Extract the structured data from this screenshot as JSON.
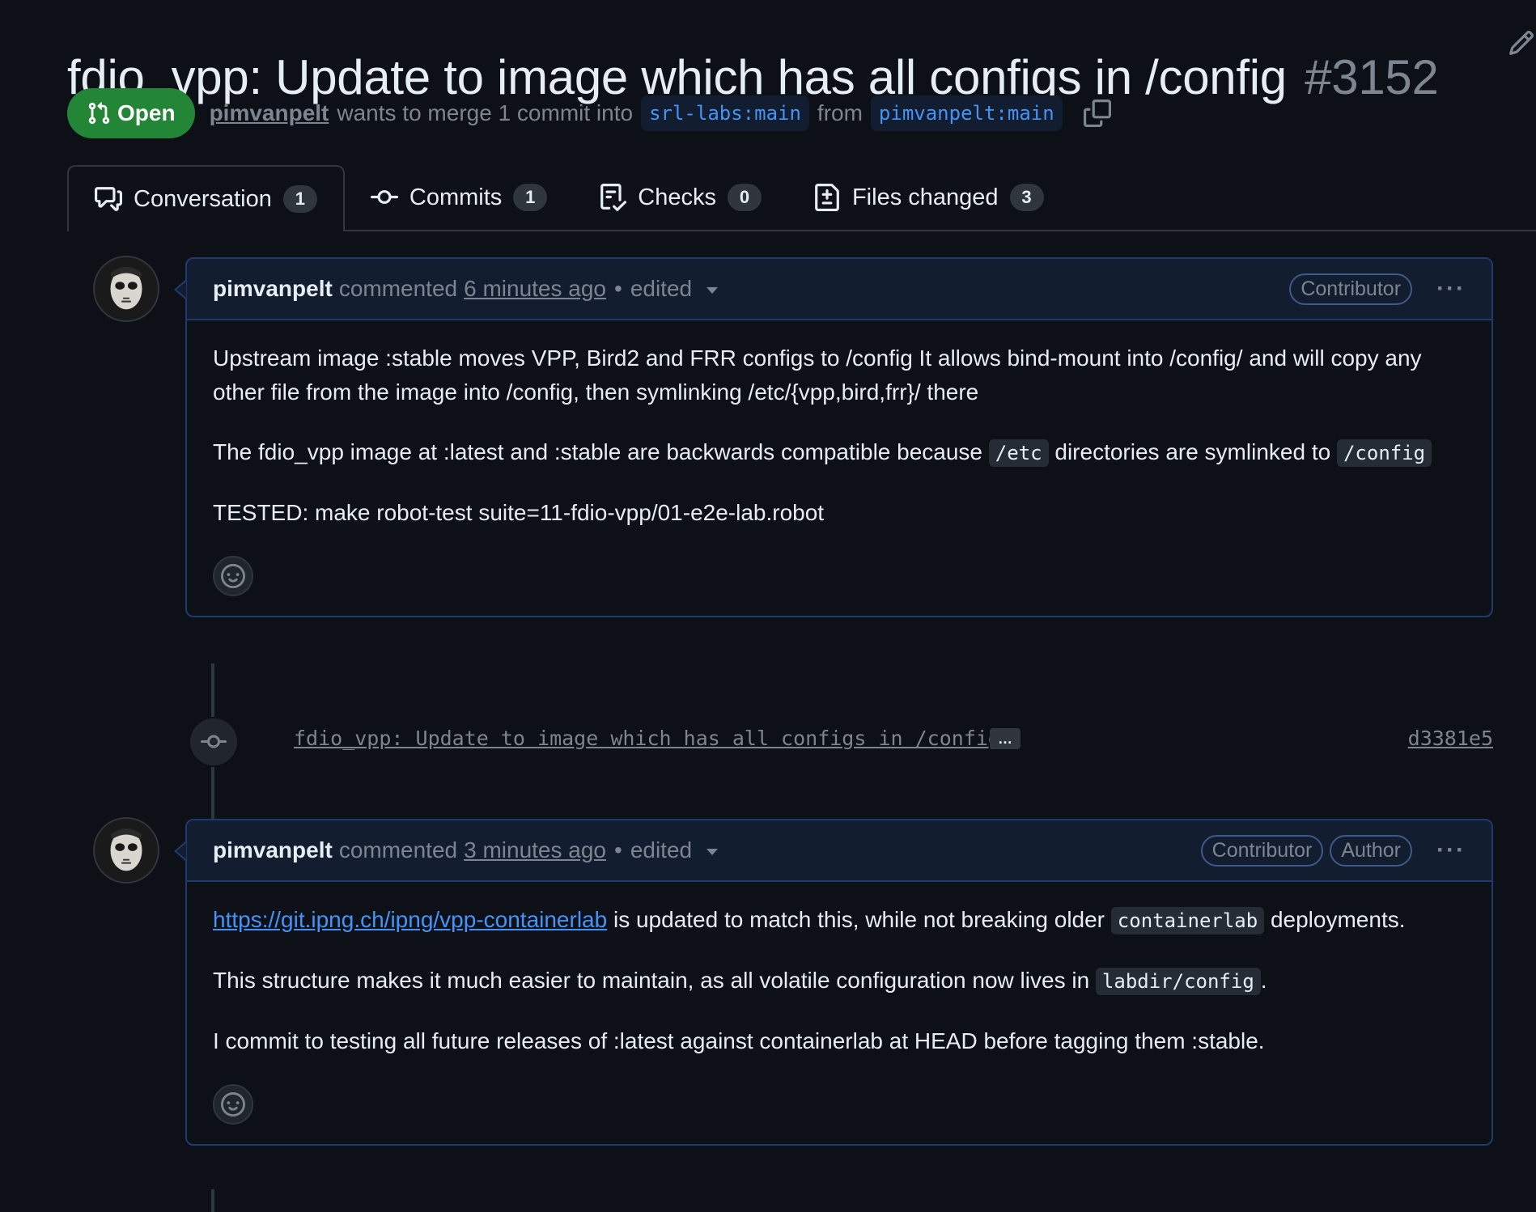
{
  "pr": {
    "title": "fdio_vpp: Update to image which has all configs in /config",
    "number": "#3152",
    "state": "Open",
    "author": "pimvanpelt",
    "merge_text": "wants to merge 1 commit into",
    "base_branch": "srl-labs:main",
    "from_text": "from",
    "head_branch": "pimvanpelt:main"
  },
  "tabs": [
    {
      "label": "Conversation",
      "count": "1",
      "icon": "comment-discussion-icon"
    },
    {
      "label": "Commits",
      "count": "1",
      "icon": "git-commit-icon"
    },
    {
      "label": "Checks",
      "count": "0",
      "icon": "checklist-icon"
    },
    {
      "label": "Files changed",
      "count": "3",
      "icon": "file-diff-icon"
    }
  ],
  "comments": [
    {
      "author": "pimvanpelt",
      "action": "commented",
      "time": "6 minutes ago",
      "dot": "•",
      "edited": "edited",
      "badges": [
        "Contributor"
      ],
      "p1": "Upstream image :stable moves VPP, Bird2 and FRR configs to /config It allows bind-mount into /config/ and will copy any other file from the image into /config, then symlinking /etc/{vpp,bird,frr}/ there",
      "p2_a": "The fdio_vpp image at :latest and :stable are backwards compatible because",
      "p2_code1": "/etc",
      "p2_b": "directories are symlinked to",
      "p2_code2": "/config",
      "p3": "TESTED: make robot-test suite=11-fdio-vpp/01-e2e-lab.robot"
    },
    {
      "author": "pimvanpelt",
      "action": "commented",
      "time": "3 minutes ago",
      "dot": "•",
      "edited": "edited",
      "badges": [
        "Contributor",
        "Author"
      ],
      "p1_link": "https://git.ipng.ch/ipng/vpp-containerlab",
      "p1_a": "is updated to match this, while not breaking older",
      "p1_code": "containerlab",
      "p1_b": "deployments.",
      "p2_a": "This structure makes it much easier to maintain, as all volatile configuration now lives in",
      "p2_code": "labdir/config",
      "p2_b": ".",
      "p3": "I commit to testing all future releases of :latest against containerlab at HEAD before tagging them :stable."
    }
  ],
  "commit": {
    "message": "fdio_vpp: Update to image which has all configs in /config",
    "ellipsis": "…",
    "sha": "d3381e5"
  },
  "colors": {
    "open": "#238636",
    "link": "#4493f8",
    "background": "#0d1117"
  }
}
